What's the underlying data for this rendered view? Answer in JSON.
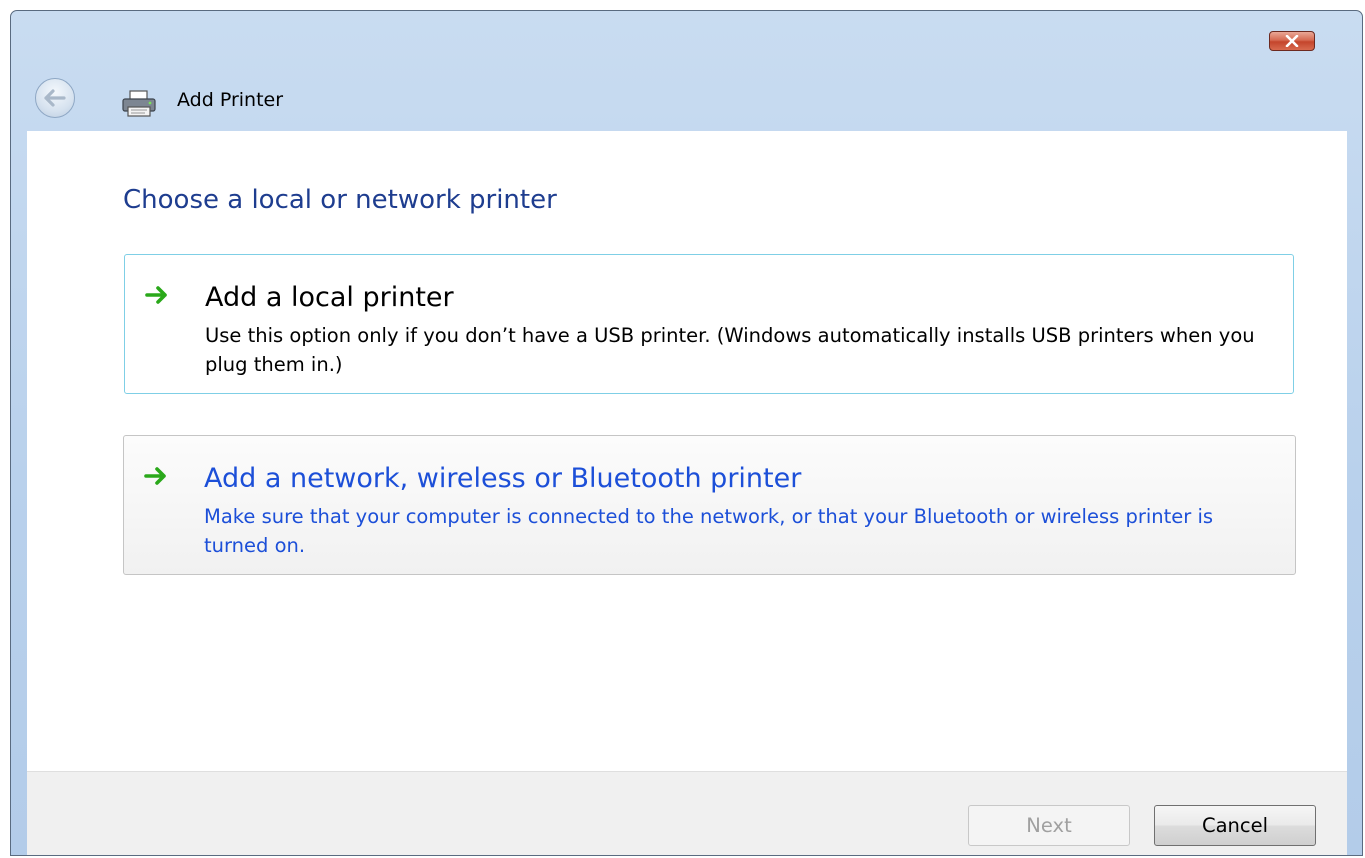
{
  "window": {
    "title": "Add Printer"
  },
  "main": {
    "heading": "Choose a local or network printer",
    "options": [
      {
        "title": "Add a local printer",
        "description": "Use this option only if you don’t have a USB printer. (Windows automatically installs USB printers when you plug them in.)"
      },
      {
        "title": "Add a network, wireless or Bluetooth printer",
        "description": "Make sure that your computer is connected to the network, or that your Bluetooth or wireless printer is turned on."
      }
    ]
  },
  "footer": {
    "next_label": "Next",
    "cancel_label": "Cancel"
  },
  "icons": {
    "back": "back-arrow-icon",
    "printer": "printer-icon",
    "close": "close-icon",
    "option_arrow": "green-arrow-icon"
  },
  "colors": {
    "heading": "#1e3d8f",
    "link_text": "#1c4fd8",
    "arrow": "#2aa81a",
    "close_button": "#c4452c",
    "title_bar": "#b9d1ec"
  }
}
